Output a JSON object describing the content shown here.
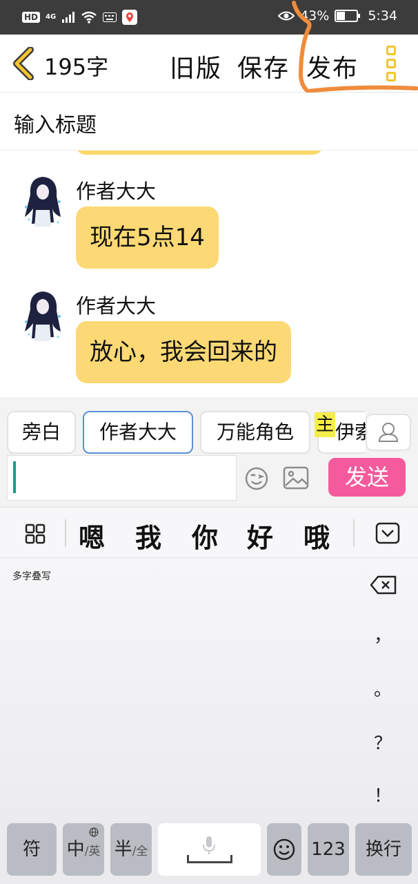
{
  "status_bar": {
    "hd": "HD",
    "network": "4G",
    "battery": "43%",
    "battery_level": 0.43,
    "time": "5:34"
  },
  "header": {
    "word_count": "195字",
    "old_version": "旧版",
    "save": "保存",
    "publish": "发布",
    "accent_color": "#f4c430",
    "annotation_color": "#ef8c3c"
  },
  "title_input": {
    "placeholder": "输入标题"
  },
  "messages": [
    {
      "author": "作者大大",
      "text": "现在5点14"
    },
    {
      "author": "作者大大",
      "text": "放心，我会回来的"
    }
  ],
  "bubble_color": "#fcd974",
  "roles": {
    "items": [
      "旁白",
      "作者大大",
      "万能角色",
      "伊索"
    ],
    "selected": "作者大大",
    "host_badge": "主"
  },
  "composer": {
    "input_value": "",
    "send": "发送",
    "send_color": "#f55b9c"
  },
  "keyboard": {
    "candidates": [
      "嗯",
      "我",
      "你",
      "好",
      "哦"
    ],
    "mode_label": "多字叠写",
    "punctuation": [
      "，",
      "。",
      "？",
      "！"
    ],
    "keys": {
      "symbols": "符",
      "zh": "中",
      "zh_sub": "/英",
      "half": "半",
      "half_sub": "/全",
      "numbers": "123",
      "newline": "换行"
    }
  }
}
